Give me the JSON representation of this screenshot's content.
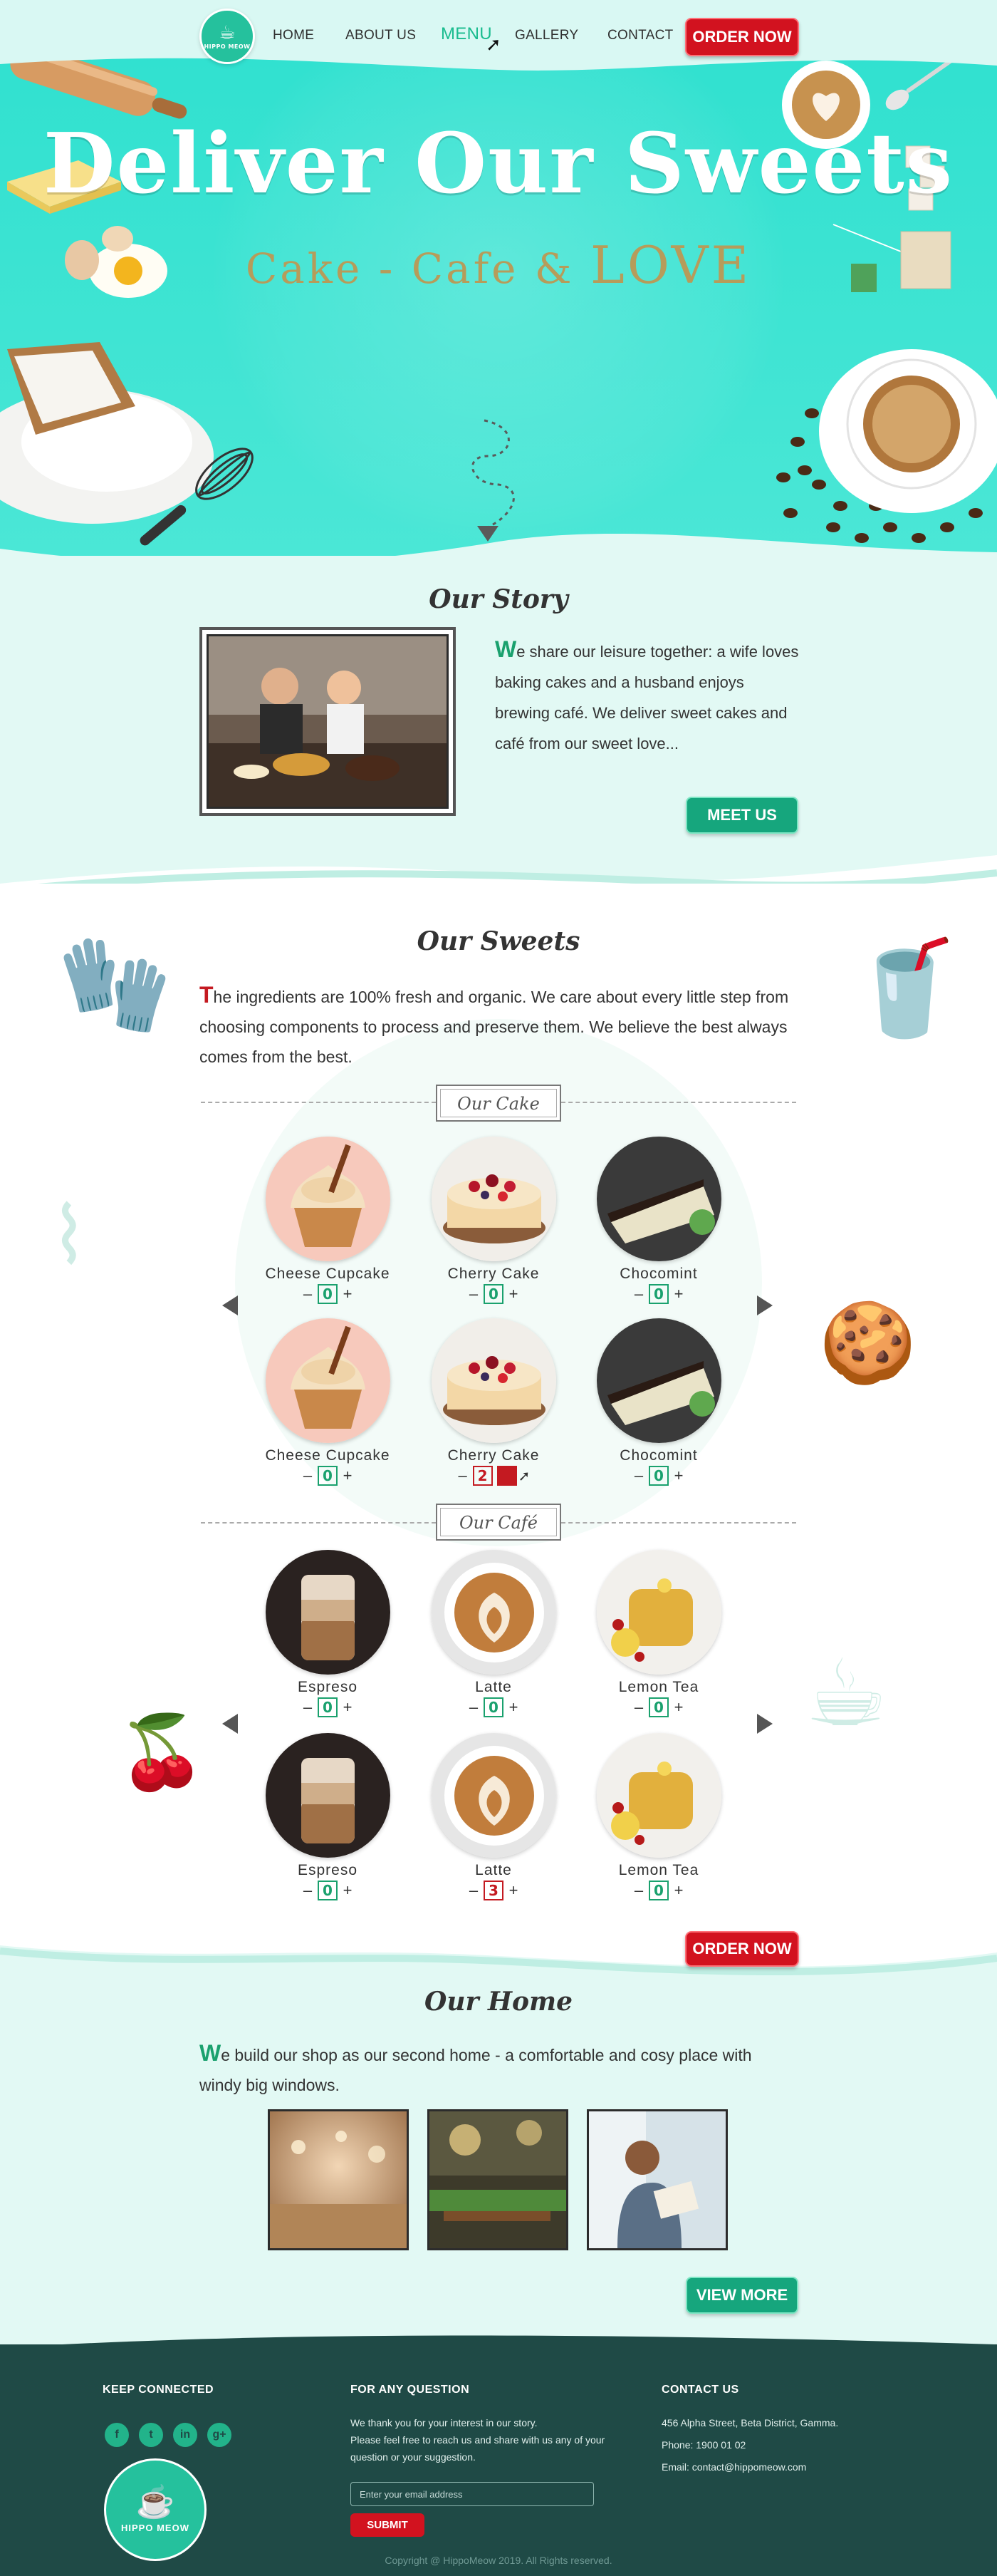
{
  "nav": {
    "logo_text": "HIPPO MEOW",
    "items": [
      "HOME",
      "ABOUT US",
      "MENU",
      "GALLERY",
      "CONTACT"
    ],
    "order_now": "ORDER NOW"
  },
  "hero": {
    "title": "Deliver Our Sweets",
    "subtitle_main": "Cake - Cafe & ",
    "subtitle_love": "LOVE"
  },
  "story": {
    "title": "Our Story",
    "dropcap": "W",
    "text": "e share our leisure together: a wife loves baking cakes and a husband enjoys brewing café. We deliver sweet cakes and café from our sweet love...",
    "button": "MEET US"
  },
  "sweets": {
    "title": "Our Sweets",
    "dropcap": "T",
    "text": "he ingredients are 100% fresh and organic. We care about every little step from choosing components to process and preserve them. We believe the best always comes from the best.",
    "cake_label": "Our Cake",
    "cafe_label": "Our Café",
    "cakes": [
      {
        "name": "Cheese Cupcake",
        "qty": "0"
      },
      {
        "name": "Cherry Cake",
        "qty": "0"
      },
      {
        "name": "Chocomint",
        "qty": "0"
      },
      {
        "name": "Cheese Cupcake",
        "qty": "0"
      },
      {
        "name": "Cherry Cake",
        "qty": "2"
      },
      {
        "name": "Chocomint",
        "qty": "0"
      }
    ],
    "cafes": [
      {
        "name": "Espreso",
        "qty": "0"
      },
      {
        "name": "Latte",
        "qty": "0"
      },
      {
        "name": "Lemon Tea",
        "qty": "0"
      },
      {
        "name": "Espreso",
        "qty": "0"
      },
      {
        "name": "Latte",
        "qty": "3"
      },
      {
        "name": "Lemon Tea",
        "qty": "0"
      }
    ],
    "minus": "–",
    "plus": "+",
    "order_now": "ORDER NOW"
  },
  "home": {
    "title": "Our Home",
    "dropcap": "W",
    "text": "e build our shop as our second home - a comfortable and cosy place with windy big windows.",
    "button": "VIEW MORE"
  },
  "footer": {
    "keep_connected": "KEEP CONNECTED",
    "social": [
      "f",
      "t",
      "in",
      "g+"
    ],
    "logo_text": "HIPPO MEOW",
    "question_title": "FOR ANY QUESTION",
    "question_text_1": "We thank you for your interest in our story.",
    "question_text_2": "Please feel free to reach us and share with us any of your",
    "question_text_3": "question or your suggestion.",
    "email_placeholder": "Enter your email address",
    "submit": "SUBMIT",
    "contact_title": "CONTACT US",
    "address": "456 Alpha Street, Beta District, Gamma.",
    "phone": "Phone: 1900 01 02",
    "email": "Email: contact@hippomeow.com",
    "copyright": "Copyright @ HippoMeow 2019. All Rights reserved."
  },
  "colors": {
    "hero_teal": "#3fe4d3",
    "brand_green": "#16a67d",
    "accent_red": "#d2121f",
    "footer_dark": "#1f4a46",
    "light_mint": "#e2f9f4"
  }
}
